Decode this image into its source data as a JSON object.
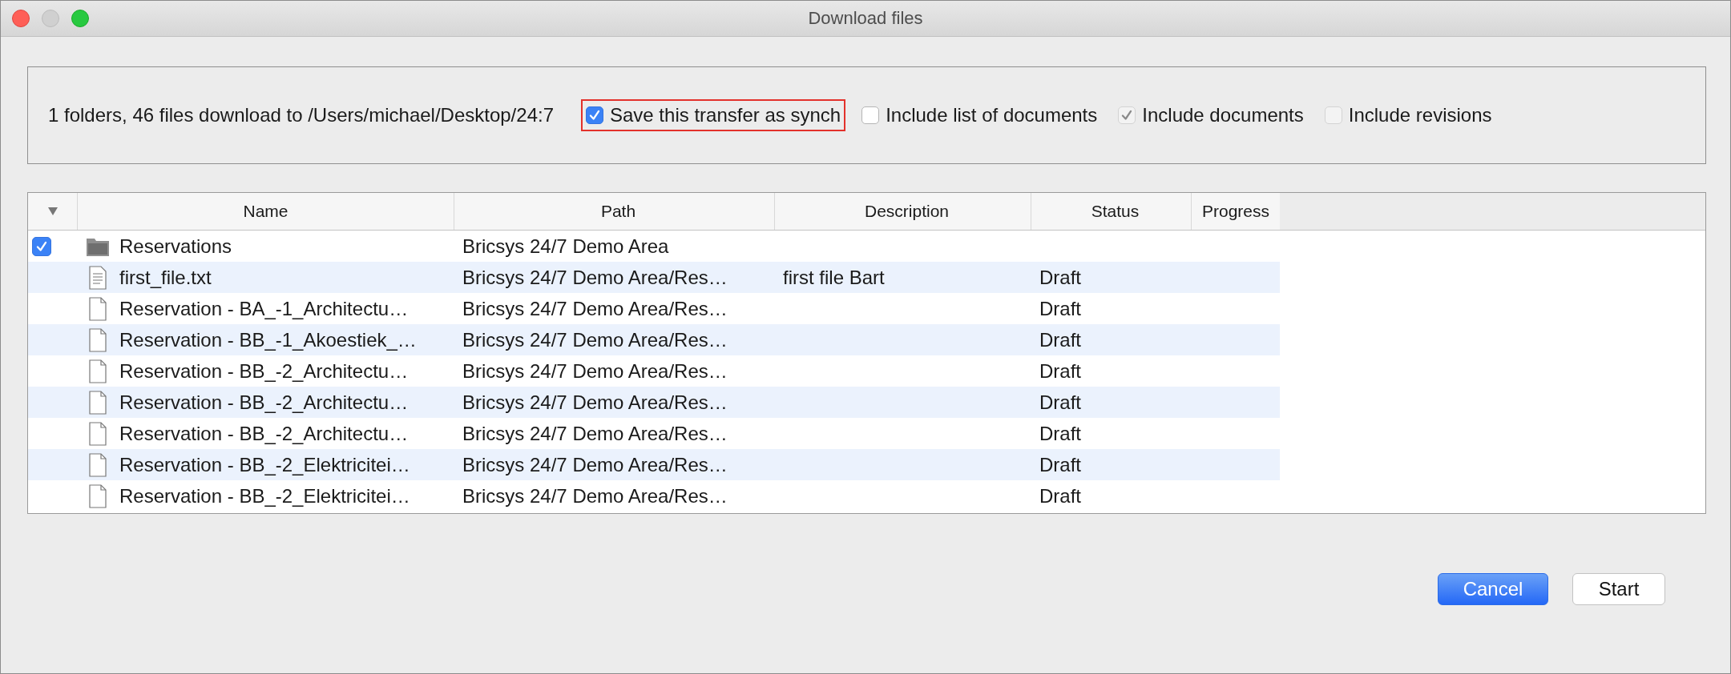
{
  "window": {
    "title": "Download files"
  },
  "options": {
    "summary": "1 folders, 46 files download to /Users/michael/Desktop/24:7",
    "checkboxes": [
      {
        "label": "Save this transfer as synch",
        "checked": true,
        "disabled": false,
        "highlighted": true
      },
      {
        "label": "Include list of documents",
        "checked": false,
        "disabled": false,
        "highlighted": false
      },
      {
        "label": "Include documents",
        "checked": true,
        "disabled": true,
        "highlighted": false
      },
      {
        "label": "Include revisions",
        "checked": false,
        "disabled": true,
        "highlighted": false
      }
    ]
  },
  "table": {
    "columns": [
      "Name",
      "Path",
      "Description",
      "Status",
      "Progress"
    ],
    "rows": [
      {
        "kind": "folder",
        "checked": true,
        "name": "Reservations",
        "path": "Bricsys 24/7 Demo Area",
        "description": "",
        "status": ""
      },
      {
        "kind": "text",
        "name": "first_file.txt",
        "path": "Bricsys 24/7 Demo Area/Res…",
        "description": "first file Bart",
        "status": "Draft"
      },
      {
        "kind": "file",
        "name": "Reservation - BA_-1_Architectu…",
        "path": "Bricsys 24/7 Demo Area/Res…",
        "description": "",
        "status": "Draft"
      },
      {
        "kind": "file",
        "name": "Reservation - BB_-1_Akoestiek_…",
        "path": "Bricsys 24/7 Demo Area/Res…",
        "description": "",
        "status": "Draft"
      },
      {
        "kind": "file",
        "name": "Reservation - BB_-2_Architectu…",
        "path": "Bricsys 24/7 Demo Area/Res…",
        "description": "",
        "status": "Draft"
      },
      {
        "kind": "file",
        "name": "Reservation - BB_-2_Architectu…",
        "path": "Bricsys 24/7 Demo Area/Res…",
        "description": "",
        "status": "Draft"
      },
      {
        "kind": "file",
        "name": "Reservation - BB_-2_Architectu…",
        "path": "Bricsys 24/7 Demo Area/Res…",
        "description": "",
        "status": "Draft"
      },
      {
        "kind": "file",
        "name": "Reservation - BB_-2_Elektricitei…",
        "path": "Bricsys 24/7 Demo Area/Res…",
        "description": "",
        "status": "Draft"
      },
      {
        "kind": "file",
        "name": "Reservation - BB_-2_Elektricitei…",
        "path": "Bricsys 24/7 Demo Area/Res…",
        "description": "",
        "status": "Draft"
      }
    ]
  },
  "buttons": [
    {
      "label": "Cancel",
      "kind": "primary"
    },
    {
      "label": "Start",
      "kind": "default"
    }
  ]
}
